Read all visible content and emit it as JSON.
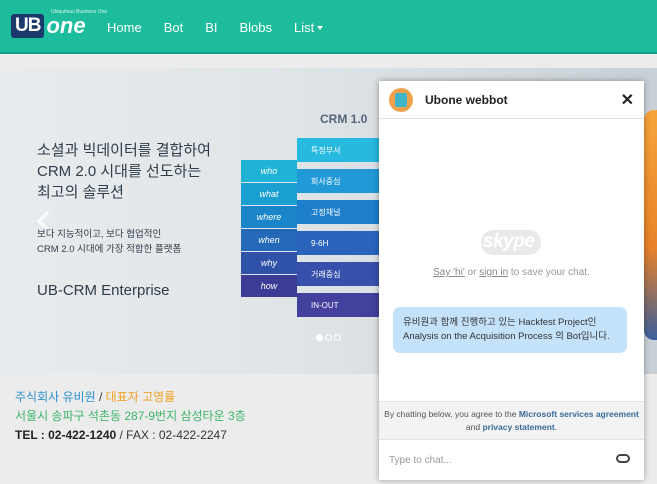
{
  "navbar": {
    "logo_ub": "UB",
    "logo_one": "one",
    "logo_tagline": "Ubiquitous Business One",
    "items": [
      {
        "label": "Home"
      },
      {
        "label": "Bot"
      },
      {
        "label": "BI"
      },
      {
        "label": "Blobs"
      },
      {
        "label": "List"
      }
    ]
  },
  "hero": {
    "headline_1": "소셜과 빅데이터를 결합하여",
    "headline_2": "CRM 2.0 시대를 선도하는",
    "headline_3": "최고의 솔루션",
    "sub_1": "보다 지능적이고, 보다 협업적인",
    "sub_2": "CRM 2.0 시대에 가장 적합한 플랫폼",
    "product": "UB-CRM Enterprise",
    "crm_label": "CRM 1.0",
    "left_words": [
      "who",
      "what",
      "where",
      "when",
      "why",
      "how"
    ],
    "right_words": [
      "특정부서",
      "회사중심",
      "고정채널",
      "9-6H",
      "거래중심",
      "IN-OUT"
    ]
  },
  "info": {
    "company": "주식회사 유비원",
    "sep": " / ",
    "ceo": "대표자 고영률",
    "address": "서울시 송파구 석촌동 287-9번지 삼성타운 3층",
    "tel_label": "TEL : 02-422-1240",
    "fax": " / FAX : 02-422-2247"
  },
  "chat": {
    "title": "Ubone webbot",
    "close": "✕",
    "skype_logo": "skype",
    "say_hi": "Say 'hi'",
    "or": " or ",
    "sign_in": "sign in",
    "to_save": " to save your chat.",
    "bubble": "유비원과 함께 진행하고 있는 Hackfest Project인 Analysis on the Acquisition Process 의 Bot입니다.",
    "legal_1": "By chatting below, you agree to the ",
    "legal_link1": "Microsoft services agreement",
    "legal_and": " and ",
    "legal_link2": "privacy statement",
    "legal_end": ".",
    "input_placeholder": "Type to chat..."
  },
  "colors": {
    "navbar": "#1cbc9c",
    "bubble": "#c5e2fb",
    "logo_dark": "#1a3a6b"
  }
}
